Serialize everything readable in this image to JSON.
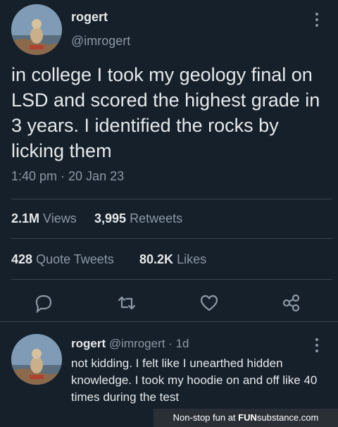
{
  "tweet": {
    "author_name": "rogert",
    "author_handle": "@imrogert",
    "text": "in college I took my geology final on LSD and scored the highest grade in 3 years. I identified the rocks by licking them",
    "timestamp": "1:40 pm · 20 Jan 23",
    "views_count": "2.1M",
    "views_label": "Views",
    "retweets_count": "3,995",
    "retweets_label": "Retweets",
    "quotes_count": "428",
    "quotes_label": "Quote Tweets",
    "likes_count": "80.2K",
    "likes_label": "Likes"
  },
  "actions": [
    "comment-icon",
    "retweet-icon",
    "heart-icon",
    "share-icon"
  ],
  "reply": {
    "author_name": "rogert",
    "author_handle": "@imrogert",
    "age": "· 1d",
    "text": "not kidding. I felt like I unearthed hidden knowledge. I took my hoodie on and off like 40 times during the test"
  },
  "watermark": {
    "prefix": "Non-stop fun at",
    "brand_bold": "FUN",
    "brand_rest": "substance.com"
  },
  "colors": {
    "background": "#15202b",
    "primary_text": "#e7e9ea",
    "secondary_text": "#8b98a5",
    "divider": "#38444d"
  }
}
